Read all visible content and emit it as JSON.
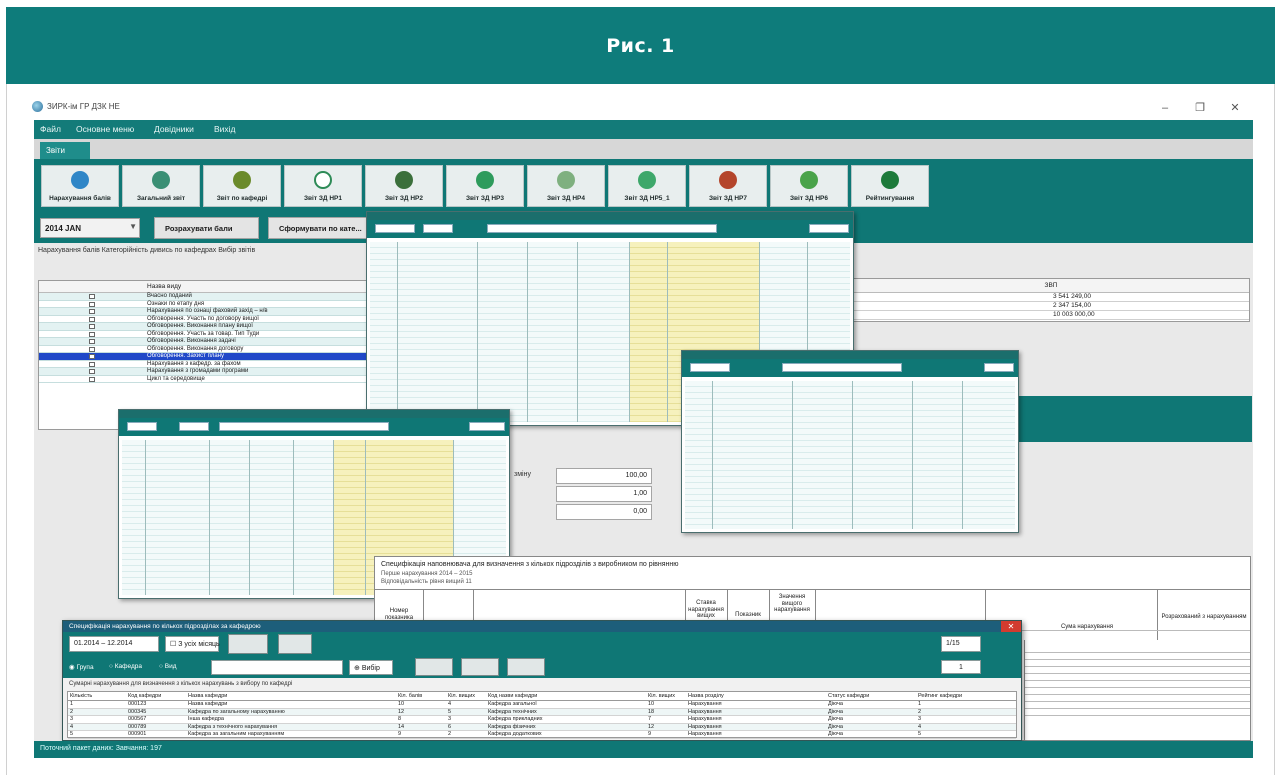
{
  "figure": {
    "title": "Рис. 1"
  },
  "window": {
    "title": "ЗИРК-ім ГР ДЗК НЕ",
    "minimize": "–",
    "maximize": "❐",
    "close": "✕"
  },
  "menu": [
    "Файл",
    "Основне меню",
    "Довідники",
    "Вихід"
  ],
  "tab": {
    "label": "Звіти"
  },
  "toolbar": [
    {
      "label": "Нарахування балів",
      "color": "#2f86c7"
    },
    {
      "label": "Загальний звіт",
      "color": "#3a8f74"
    },
    {
      "label": "Звіт по кафедрі",
      "color": "#6a8a2a"
    },
    {
      "label": "Звіт ЗД НР1",
      "color": "#ffffff"
    },
    {
      "label": "Звіт ЗД НР2",
      "color": "#3b6f3b"
    },
    {
      "label": "Звіт ЗД НР3",
      "color": "#2e9b5c"
    },
    {
      "label": "Звіт ЗД НР4",
      "color": "#7fb07f"
    },
    {
      "label": "Звіт ЗД НР5_1",
      "color": "#3da76a"
    },
    {
      "label": "Звіт ЗД НР7",
      "color": "#b4452b"
    },
    {
      "label": "Звіт ЗД НР6",
      "color": "#4aa34a"
    },
    {
      "label": "Рейтингування",
      "color": "#1d7a3a"
    }
  ],
  "controls": {
    "month": "2014 JAN",
    "btn_recalc": "Розрахувати бали",
    "btn_form": "Сформувати по кате..."
  },
  "subtabs": "Нарахування балів  Категорійність  дивись по кафедрах  Вибір звітів",
  "left_grid": {
    "header": "Назва виду",
    "rows": [
      "Вчасно поданий",
      "Ознаки по етапу дня",
      "Нарахування по ознаці фаховий захід – н/в",
      "Обговорення. Участь по договору вищої",
      "Обговорення. Виконання плану вищої",
      "Обговорення. Участь за товар. Тип Туди",
      "Обговорення. Виконання задачі",
      "Обговорення. Виконання договору",
      "Обговорення. Захист плану",
      "Нарахування з кафедр. за фахом",
      "Нарахування з громадами програми",
      "Цикл та середовище"
    ],
    "selected_index": 8
  },
  "right_panel": {
    "header": "ЗВП",
    "values": [
      "3 541 249,00",
      "2 347 154,00",
      "10 003 000,00"
    ]
  },
  "fields": {
    "label": "зміну",
    "values": [
      "100,00",
      "1,00",
      "0,00"
    ]
  },
  "document": {
    "title": "Специфікація наповнювача для визначення з кількох підрозділів з виробником по рівнянню",
    "line2": "Перше нарахування 2014 – 2015",
    "line3": "Відповідальність рівня вищий 11",
    "head1": "Номер показника",
    "head2": "Ставка нарахування вищих",
    "head3": "Показник",
    "head4": "Значення вищого нарахування",
    "head5": "Сума нарахування",
    "head6": "Розрахований з нарахуванням"
  },
  "dialog": {
    "title": "Специфікація нарахування по кількох підрозділах за кафедрою",
    "date_range": "01.2014 – 12.2014",
    "checkbox": "З усіх місяць",
    "radio1": "Група",
    "radio2": "Кафедра",
    "radio3": "Вид",
    "btn_find": "Вибір",
    "page": "1/15",
    "spinner": "1",
    "caption": "Сумарні нарахування для визначення з кількох нарахувань з вибору по кафедрі",
    "columns": [
      "Кількість",
      "Код кафедри",
      "Назва кафедри",
      "Кіл. балів",
      "Кіл. вищих",
      "Код назви кафедри",
      "Кіл. вищих",
      "Назва розділу",
      "Статус кафедри",
      "Рейтинг кафедри"
    ],
    "rows": [
      [
        "1",
        "000123",
        "Назва кафедри",
        "10",
        "4",
        "Кафедра загальної",
        "10",
        "Нарахування",
        "Діюча",
        "1"
      ],
      [
        "2",
        "000345",
        "Кафедра по загальному нарахуванню",
        "12",
        "5",
        "Кафедра технічних",
        "18",
        "Нарахування",
        "Діюча",
        "2"
      ],
      [
        "3",
        "000567",
        "Інша кафедра",
        "8",
        "3",
        "Кафедра прикладних",
        "7",
        "Нарахування",
        "Діюча",
        "3"
      ],
      [
        "4",
        "000789",
        "Кафедра з технічного нарахування",
        "14",
        "6",
        "Кафедра фізичних",
        "12",
        "Нарахування",
        "Діюча",
        "4"
      ],
      [
        "5",
        "000901",
        "Кафедра за загальним нарахуванням",
        "9",
        "2",
        "Кафедра додаткових",
        "9",
        "Нарахування",
        "Діюча",
        "5"
      ]
    ]
  },
  "statusbar": "Поточний пакет даних: Завчання: 197"
}
